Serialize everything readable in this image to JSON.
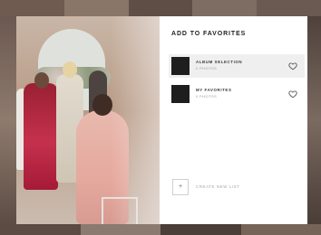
{
  "modal": {
    "title": "ADD TO FAVORITES"
  },
  "favorites": {
    "lists": [
      {
        "name": "ALBUM SELECTION",
        "count": "0 PHOTOS",
        "highlighted": true,
        "thumb_color": "#1e1e1e",
        "icon": "heart-outline-icon"
      },
      {
        "name": "MY FAVORITES",
        "count": "0 PHOTOS",
        "highlighted": false,
        "thumb_color": "#1e1e1e",
        "icon": "heart-outline-icon"
      }
    ],
    "create": {
      "icon": "plus-icon",
      "plus_glyph": "+",
      "label": "CREATE NEW LIST"
    }
  },
  "colors": {
    "accent": "#1e1e1e",
    "highlight_row": "#efefef",
    "muted_text": "#9a9a9a"
  }
}
